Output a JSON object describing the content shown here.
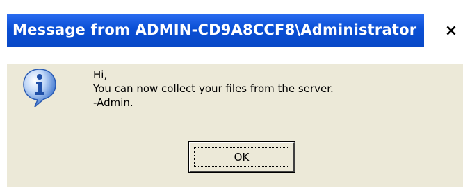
{
  "dialog": {
    "title": "Message from ADMIN-CD9A8CCF8\\Administrator",
    "close_glyph": "×",
    "icon": "info-icon",
    "message_lines": [
      "Hi,",
      "You can now collect your files from the server.",
      "-Admin."
    ],
    "ok_label": "OK"
  },
  "colors": {
    "titlebar": "#0A52D6",
    "dialog_face": "#ECE9D8",
    "info_icon": "#2F6FD6"
  }
}
